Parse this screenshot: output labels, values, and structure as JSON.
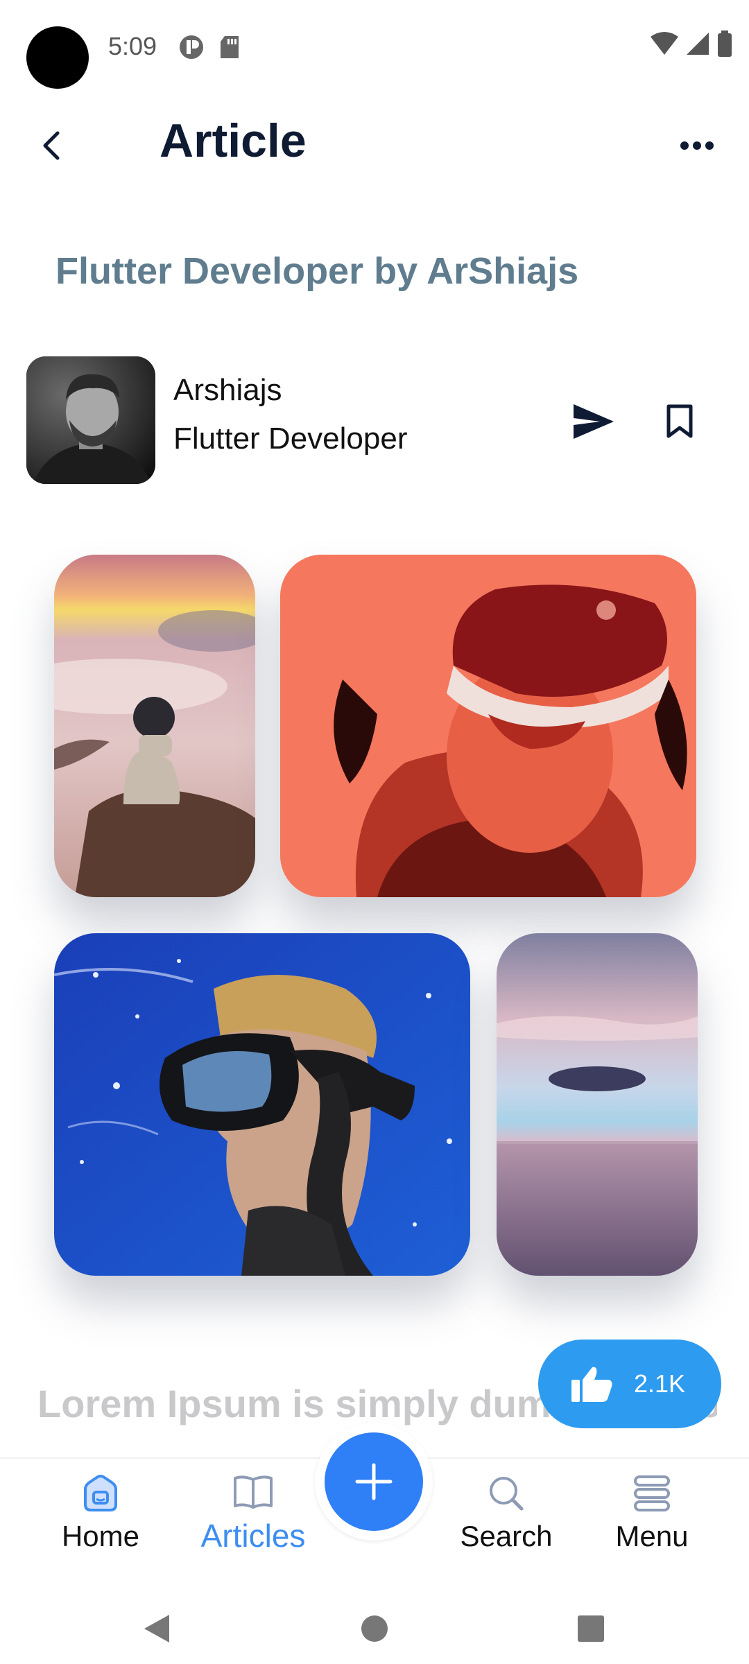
{
  "status_bar": {
    "time": "5:09"
  },
  "app_bar": {
    "title": "Article"
  },
  "article": {
    "heading": "Flutter Developer by ArShiajs",
    "body_preview": "Lorem Ipsum is simply dummy text of the printing and typesetting industry."
  },
  "author": {
    "name": "Arshiajs",
    "role": "Flutter Developer"
  },
  "like": {
    "count": "2.1K"
  },
  "bottom_nav": {
    "items": [
      {
        "label": "Home",
        "icon": "home-icon"
      },
      {
        "label": "Articles",
        "icon": "book-icon",
        "active": true
      },
      {
        "label": "Search",
        "icon": "search-icon"
      },
      {
        "label": "Menu",
        "icon": "menu-icon"
      }
    ],
    "fab_icon": "plus-icon"
  },
  "colors": {
    "accent": "#2f80f6",
    "like": "#2d9bf0",
    "heading": "#5f7d8e",
    "active_nav": "#3d8ef0"
  }
}
